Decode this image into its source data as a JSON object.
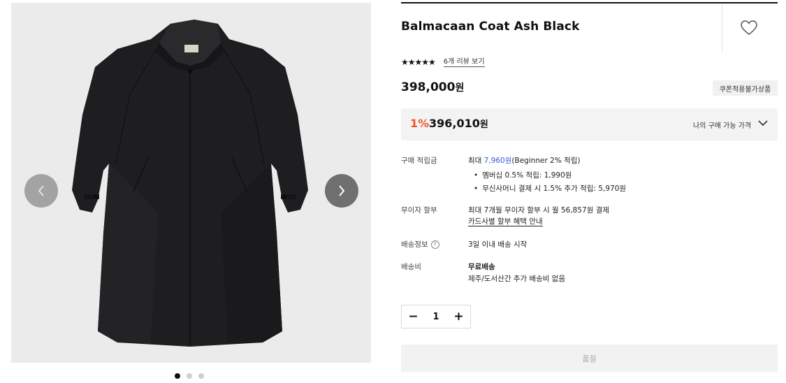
{
  "gallery": {
    "prev_icon": "chevron-left-icon",
    "next_icon": "chevron-right-icon",
    "dots": [
      true,
      false,
      false
    ],
    "image_alt": "black balmacaan coat",
    "coat_label": "manaph ••••"
  },
  "product": {
    "title": "Balmacaan Coat Ash Black",
    "wishlist_icon": "heart-icon",
    "stars": "★★★★★",
    "review_link": "6개 리뷰 보기",
    "price_number": "398,000",
    "price_unit": "원",
    "coupon_badge": "쿠폰적용불가상품"
  },
  "my_price": {
    "discount": "1%",
    "price_number": "396,010",
    "price_unit": "원",
    "label": "나의 구매 가능 가격"
  },
  "points": {
    "label": "구매 적립금",
    "prefix": "최대 ",
    "amount": "7,960원",
    "suffix": "(Beginner 2% 적립)",
    "bullets": [
      "멤버십 0.5% 적립: 1,990원",
      "무신사머니 결제 시 1.5% 추가 적립: 5,970원"
    ]
  },
  "installment": {
    "label": "무이자 할부",
    "value": "최대 7개월 무이자 할부 시 월 56,857원 결제",
    "link": "카드사별 할부 혜택 안내"
  },
  "shipping_info": {
    "label": "배송정보",
    "help": "?",
    "value": "3일 이내 배송 시작"
  },
  "shipping_fee": {
    "label": "배송비",
    "value": "무료배송",
    "note": "제주/도서산간 추가 배송비 없음"
  },
  "quantity": {
    "minus": "−",
    "value": "1",
    "plus": "+"
  },
  "soldout_label": "품절",
  "colors": {
    "discount": "#f0572b",
    "link_blue": "#3a5bd9"
  }
}
